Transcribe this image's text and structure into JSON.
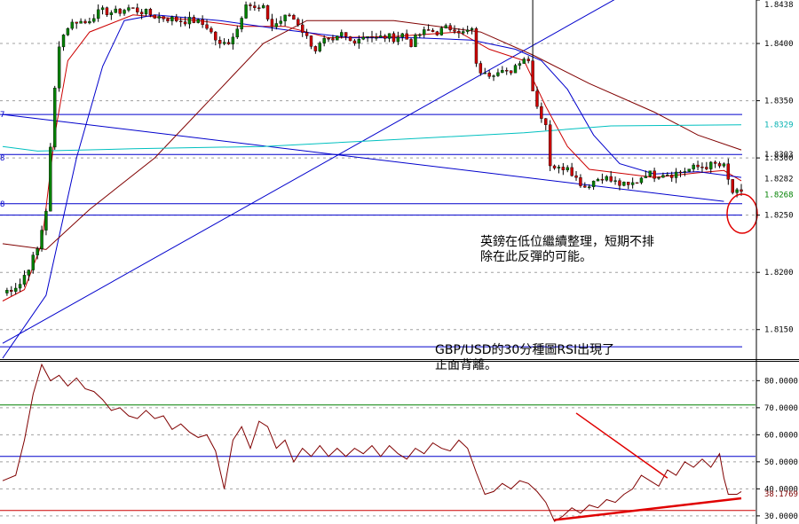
{
  "chart_data": [
    {
      "type": "candlestick",
      "pair": "GBP/USD",
      "timeframe": "30 minute",
      "ylim": [
        1.8125,
        1.8438
      ],
      "y_ticks": [
        {
          "value": 1.84,
          "label": "1.8400"
        },
        {
          "value": 1.835,
          "label": "1.8350"
        },
        {
          "value": 1.83,
          "label": "1.8300"
        },
        {
          "value": 1.825,
          "label": "1.8250"
        },
        {
          "value": 1.82,
          "label": "1.8200"
        },
        {
          "value": 1.815,
          "label": "1.8150"
        },
        {
          "value": 1.8438,
          "label": "1.8438"
        }
      ],
      "price_labels": [
        {
          "value": 1.8329,
          "label": "1.8329",
          "color": "#00b0b0"
        },
        {
          "value": 1.8303,
          "label": "1.8303",
          "color": "#000000"
        },
        {
          "value": 1.8282,
          "label": "1.8282",
          "color": "#000000"
        },
        {
          "value": 1.8268,
          "label": "1.8268",
          "color": "#008000"
        }
      ],
      "left_edge_labels": [
        {
          "value": 1.8338,
          "label": "7"
        },
        {
          "value": 1.83,
          "label": "8"
        },
        {
          "value": 1.826,
          "label": "8"
        }
      ],
      "horizontal_levels": [
        1.8338,
        1.8303,
        1.826,
        1.825,
        1.8135
      ],
      "close_path": [
        [
          0,
          1.8182
        ],
        [
          4,
          1.819
        ],
        [
          8,
          1.822
        ],
        [
          10,
          1.8255
        ],
        [
          12,
          1.836
        ],
        [
          13,
          1.84
        ],
        [
          15,
          1.8415
        ],
        [
          17,
          1.842
        ],
        [
          19,
          1.8418
        ],
        [
          21,
          1.8425
        ],
        [
          23,
          1.8428
        ],
        [
          26,
          1.8427
        ],
        [
          29,
          1.8431
        ],
        [
          32,
          1.8428
        ],
        [
          35,
          1.8424
        ],
        [
          38,
          1.8422
        ],
        [
          41,
          1.842
        ],
        [
          44,
          1.842
        ],
        [
          47,
          1.8415
        ],
        [
          50,
          1.8398
        ],
        [
          52,
          1.8402
        ],
        [
          54,
          1.8413
        ],
        [
          56,
          1.8437
        ],
        [
          58,
          1.843
        ],
        [
          60,
          1.843
        ],
        [
          62,
          1.8415
        ],
        [
          64,
          1.842
        ],
        [
          66,
          1.8425
        ],
        [
          68,
          1.8418
        ],
        [
          70,
          1.8405
        ],
        [
          72,
          1.8395
        ],
        [
          74,
          1.8402
        ],
        [
          76,
          1.84
        ],
        [
          78,
          1.8408
        ],
        [
          80,
          1.8402
        ],
        [
          82,
          1.8405
        ],
        [
          84,
          1.8408
        ],
        [
          86,
          1.8404
        ],
        [
          88,
          1.8406
        ],
        [
          90,
          1.8405
        ],
        [
          92,
          1.8408
        ],
        [
          94,
          1.84
        ],
        [
          96,
          1.8408
        ],
        [
          98,
          1.8411
        ],
        [
          100,
          1.841
        ],
        [
          102,
          1.8413
        ],
        [
          104,
          1.8414
        ],
        [
          106,
          1.8409
        ],
        [
          108,
          1.8412
        ],
        [
          109,
          1.838
        ],
        [
          111,
          1.8372
        ],
        [
          113,
          1.8375
        ],
        [
          115,
          1.838
        ],
        [
          117,
          1.8372
        ],
        [
          119,
          1.8385
        ],
        [
          121,
          1.8388
        ],
        [
          122,
          1.836
        ],
        [
          123,
          1.8345
        ],
        [
          125,
          1.833
        ],
        [
          126,
          1.8295
        ],
        [
          128,
          1.829
        ],
        [
          130,
          1.8294
        ],
        [
          132,
          1.8282
        ],
        [
          134,
          1.8275
        ],
        [
          136,
          1.828
        ],
        [
          138,
          1.8284
        ],
        [
          140,
          1.828
        ],
        [
          142,
          1.8277
        ],
        [
          144,
          1.8275
        ],
        [
          146,
          1.828
        ],
        [
          148,
          1.8287
        ],
        [
          150,
          1.8285
        ],
        [
          152,
          1.8287
        ],
        [
          154,
          1.8286
        ],
        [
          156,
          1.8288
        ],
        [
          158,
          1.829
        ],
        [
          160,
          1.8292
        ],
        [
          162,
          1.8293
        ],
        [
          164,
          1.8294
        ],
        [
          166,
          1.8292
        ],
        [
          167,
          1.828
        ],
        [
          168,
          1.827
        ],
        [
          170,
          1.8268
        ]
      ],
      "moving_averages": [
        {
          "color": "#cc0000",
          "points": [
            [
              0,
              1.8175
            ],
            [
              5,
              1.8185
            ],
            [
              9,
              1.8225
            ],
            [
              12,
              1.832
            ],
            [
              15,
              1.8385
            ],
            [
              20,
              1.841
            ],
            [
              30,
              1.8425
            ],
            [
              45,
              1.842
            ],
            [
              55,
              1.8415
            ],
            [
              65,
              1.8415
            ],
            [
              75,
              1.8405
            ],
            [
              90,
              1.8406
            ],
            [
              105,
              1.841
            ],
            [
              112,
              1.8395
            ],
            [
              120,
              1.8385
            ],
            [
              125,
              1.8345
            ],
            [
              130,
              1.831
            ],
            [
              135,
              1.829
            ],
            [
              150,
              1.8283
            ],
            [
              160,
              1.8287
            ],
            [
              166,
              1.8289
            ],
            [
              170,
              1.828
            ]
          ]
        },
        {
          "color": "#0000cc",
          "points": [
            [
              0,
              1.8125
            ],
            [
              10,
              1.818
            ],
            [
              17,
              1.83
            ],
            [
              23,
              1.838
            ],
            [
              28,
              1.842
            ],
            [
              35,
              1.8425
            ],
            [
              50,
              1.842
            ],
            [
              65,
              1.8412
            ],
            [
              80,
              1.8405
            ],
            [
              95,
              1.8405
            ],
            [
              108,
              1.8403
            ],
            [
              118,
              1.8395
            ],
            [
              124,
              1.8385
            ],
            [
              130,
              1.836
            ],
            [
              136,
              1.832
            ],
            [
              142,
              1.8295
            ],
            [
              150,
              1.8286
            ],
            [
              160,
              1.8288
            ],
            [
              170,
              1.8283
            ]
          ]
        },
        {
          "color": "#800000",
          "points": [
            [
              0,
              1.8225
            ],
            [
              10,
              1.822
            ],
            [
              20,
              1.8255
            ],
            [
              35,
              1.83
            ],
            [
              50,
              1.836
            ],
            [
              60,
              1.84
            ],
            [
              70,
              1.842
            ],
            [
              90,
              1.842
            ],
            [
              110,
              1.841
            ],
            [
              122,
              1.839
            ],
            [
              135,
              1.8365
            ],
            [
              150,
              1.834
            ],
            [
              160,
              1.832
            ],
            [
              170,
              1.8307
            ]
          ]
        },
        {
          "color": "#00c0c0",
          "points": [
            [
              0,
              1.831
            ],
            [
              8,
              1.8306
            ],
            [
              30,
              1.8308
            ],
            [
              60,
              1.831
            ],
            [
              90,
              1.8316
            ],
            [
              120,
              1.8322
            ],
            [
              140,
              1.8328
            ],
            [
              170,
              1.8329
            ]
          ]
        }
      ],
      "trendlines": [
        {
          "color": "#0000cc",
          "from": [
            0,
            1.8338
          ],
          "to": [
            166,
            1.8262
          ]
        },
        {
          "color": "#0000cc",
          "from": [
            0,
            1.8138
          ],
          "to": [
            158,
            1.8475
          ]
        }
      ],
      "annotation": "英鎊在低位繼續整理，短期不排除在此反彈的可能。"
    },
    {
      "type": "line",
      "indicator": "RSI",
      "ylim": [
        27,
        87
      ],
      "y_ticks": [
        {
          "value": 80,
          "label": "80.0000"
        },
        {
          "value": 70,
          "label": "70.0000"
        },
        {
          "value": 60,
          "label": "60.0000"
        },
        {
          "value": 50,
          "label": "50.0000"
        },
        {
          "value": 40,
          "label": "40.0000"
        },
        {
          "value": 30,
          "label": "30.0000"
        }
      ],
      "current_value": {
        "value": 38.1769,
        "label": "38.1769"
      },
      "levels": [
        {
          "value": 71,
          "color": "#008000"
        },
        {
          "value": 52,
          "color": "#0000cc"
        },
        {
          "value": 32,
          "color": "#cc0000"
        }
      ],
      "rsi_path": [
        [
          0,
          43
        ],
        [
          3,
          45
        ],
        [
          5,
          58
        ],
        [
          7,
          75
        ],
        [
          9,
          86
        ],
        [
          11,
          80
        ],
        [
          13,
          82
        ],
        [
          15,
          78
        ],
        [
          17,
          81
        ],
        [
          19,
          77
        ],
        [
          21,
          76
        ],
        [
          23,
          73
        ],
        [
          25,
          69
        ],
        [
          27,
          70
        ],
        [
          29,
          67
        ],
        [
          31,
          66
        ],
        [
          33,
          69
        ],
        [
          35,
          66
        ],
        [
          37,
          67
        ],
        [
          39,
          62
        ],
        [
          41,
          64
        ],
        [
          43,
          61
        ],
        [
          45,
          59
        ],
        [
          47,
          60
        ],
        [
          49,
          54
        ],
        [
          51,
          40
        ],
        [
          53,
          58
        ],
        [
          55,
          63
        ],
        [
          57,
          55
        ],
        [
          59,
          65
        ],
        [
          61,
          63
        ],
        [
          63,
          55
        ],
        [
          65,
          58
        ],
        [
          67,
          50
        ],
        [
          69,
          55
        ],
        [
          71,
          52
        ],
        [
          73,
          56
        ],
        [
          75,
          52
        ],
        [
          77,
          55
        ],
        [
          79,
          52
        ],
        [
          81,
          55
        ],
        [
          83,
          53
        ],
        [
          85,
          56
        ],
        [
          87,
          52
        ],
        [
          89,
          56
        ],
        [
          91,
          53
        ],
        [
          93,
          51
        ],
        [
          95,
          55
        ],
        [
          97,
          53
        ],
        [
          99,
          57
        ],
        [
          101,
          55
        ],
        [
          103,
          54
        ],
        [
          105,
          58
        ],
        [
          107,
          55
        ],
        [
          109,
          46
        ],
        [
          111,
          38
        ],
        [
          113,
          39
        ],
        [
          115,
          42
        ],
        [
          117,
          40
        ],
        [
          119,
          43
        ],
        [
          121,
          42
        ],
        [
          123,
          39
        ],
        [
          125,
          35
        ],
        [
          127,
          28
        ],
        [
          129,
          30
        ],
        [
          131,
          33
        ],
        [
          133,
          31
        ],
        [
          135,
          34
        ],
        [
          137,
          33
        ],
        [
          139,
          36
        ],
        [
          141,
          35
        ],
        [
          143,
          38
        ],
        [
          145,
          40
        ],
        [
          147,
          45
        ],
        [
          149,
          43
        ],
        [
          151,
          41
        ],
        [
          153,
          47
        ],
        [
          155,
          45
        ],
        [
          157,
          50
        ],
        [
          159,
          48
        ],
        [
          161,
          51
        ],
        [
          163,
          48
        ],
        [
          165,
          53
        ],
        [
          166,
          44
        ],
        [
          167,
          38
        ],
        [
          169,
          38
        ],
        [
          170,
          39
        ]
      ],
      "divergence_lines": [
        {
          "from": [
            127,
            28.5
          ],
          "to": [
            170,
            36.5
          ]
        },
        {
          "from": [
            132,
            68
          ],
          "to": [
            153,
            44
          ]
        }
      ],
      "annotation": "GBP/USD的30分種圖RSI出現了正面背離。"
    }
  ],
  "colors": {
    "bull_body": "#008000",
    "bear_body": "#cc0000",
    "wick": "#000000",
    "grid": "#a0a0a0",
    "highlight": "#e00000"
  }
}
